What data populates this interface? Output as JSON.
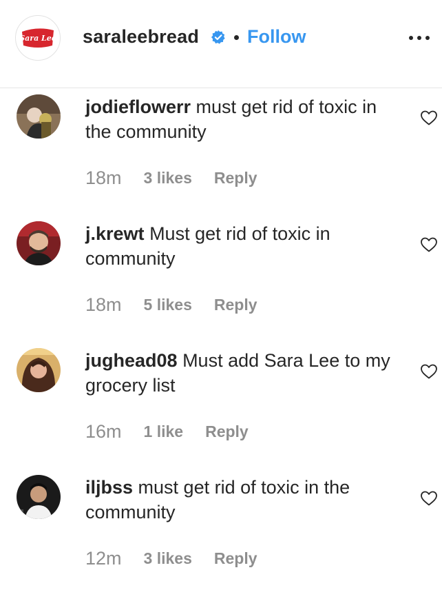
{
  "header": {
    "brand_logo_text": "Sara Lee",
    "username": "saraleebread",
    "separator": "•",
    "follow_label": "Follow"
  },
  "colors": {
    "link_blue": "#3897f0",
    "verified_blue": "#3897f0",
    "meta_gray": "#8e8e8e",
    "brand_red": "#d7262e"
  },
  "icons": {
    "verified": "verified-badge-icon",
    "more": "more-options-icon",
    "like": "heart-outline-icon"
  },
  "comments": [
    {
      "username": "jodieflowerr",
      "text": "must get rid of toxic in the community",
      "time": "18m",
      "likes": "3 likes",
      "reply": "Reply"
    },
    {
      "username": "j.krewt",
      "text": "Must get rid of toxic in community",
      "time": "18m",
      "likes": "5 likes",
      "reply": "Reply"
    },
    {
      "username": "jughead08",
      "text": "Must add Sara Lee to my grocery list",
      "time": "16m",
      "likes": "1 like",
      "reply": "Reply"
    },
    {
      "username": "iljbss",
      "text": "must get rid of toxic in the community",
      "time": "12m",
      "likes": "3 likes",
      "reply": "Reply"
    }
  ]
}
